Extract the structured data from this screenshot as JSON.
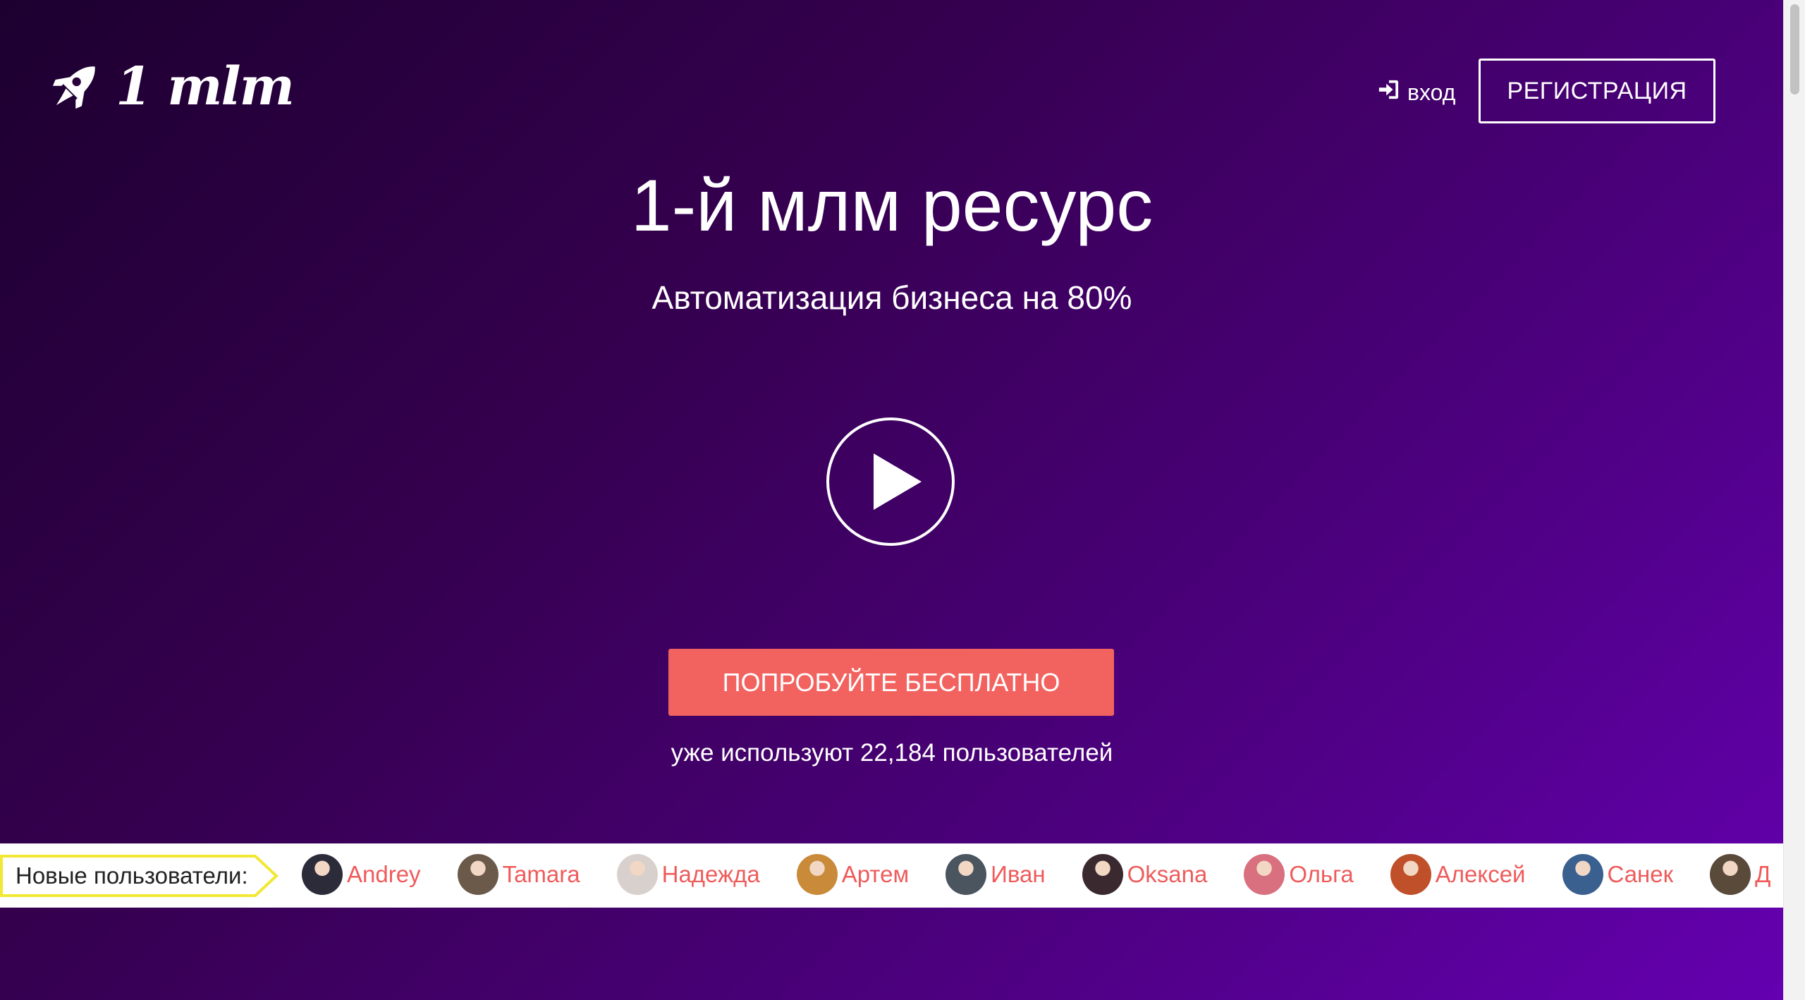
{
  "header": {
    "logo_text": "1 mlm",
    "login_label": "вход",
    "register_label": "РЕГИСТРАЦИЯ"
  },
  "hero": {
    "title": "1-й млм ресурс",
    "subtitle": "Автоматизация бизнеса на 80%",
    "cta_label": "ПОПРОБУЙТЕ БЕСПЛАТНО",
    "users_count_text": "уже используют 22,184 пользователей"
  },
  "new_users": {
    "label": "Новые пользователи:",
    "users": [
      {
        "name": "Andrey",
        "avatar_color": "#2b2b3a"
      },
      {
        "name": "Tamara",
        "avatar_color": "#6b5a4a"
      },
      {
        "name": "Надежда",
        "avatar_color": "#d8d0cc"
      },
      {
        "name": "Артем",
        "avatar_color": "#c98a3a"
      },
      {
        "name": "Иван",
        "avatar_color": "#4a5560"
      },
      {
        "name": "Oksana",
        "avatar_color": "#3a2a30"
      },
      {
        "name": "Ольга",
        "avatar_color": "#d87080"
      },
      {
        "name": "Алексей",
        "avatar_color": "#c0502a"
      },
      {
        "name": "Санек",
        "avatar_color": "#3a6090"
      },
      {
        "name": "Д",
        "avatar_color": "#5a4a3a"
      }
    ]
  },
  "colors": {
    "gradient_start": "#1d0030",
    "gradient_end": "#6400b0",
    "accent": "#f26360",
    "label_border": "#f2e833",
    "user_name": "#ef5b5b"
  },
  "icons": {
    "logo": "rocket-icon",
    "login": "sign-in-icon",
    "play": "play-icon"
  }
}
